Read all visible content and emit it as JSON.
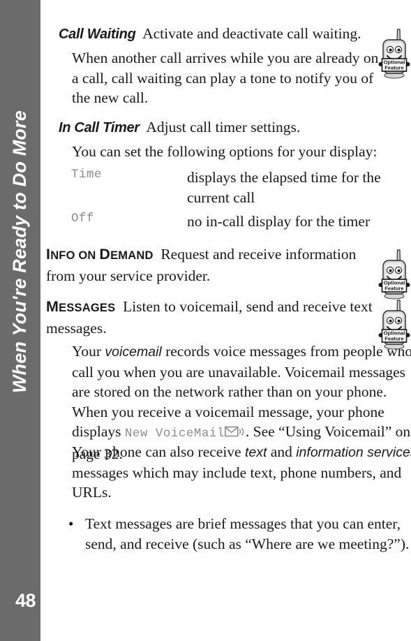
{
  "sidebar": {
    "chapter_title": "When You're Ready to Do More",
    "page_number": "48"
  },
  "content": {
    "entries": [
      {
        "term": "Call Waiting",
        "summary": "Activate and deactivate call waiting.",
        "detail": "When another call arrives while you are already on a call, call waiting can play a tone to notify you of the new call."
      },
      {
        "term": "In Call Timer",
        "summary": "Adjust call timer settings.",
        "detail": "You can set the following options for your display:"
      }
    ],
    "options": [
      {
        "name": "Time",
        "description": "displays the elapsed time for the current call"
      },
      {
        "name": "Off",
        "description": "no in-call display for the timer"
      }
    ],
    "info_on_demand": {
      "heading_first": "I",
      "heading_rest": "nfo on ",
      "heading_cap2": "D",
      "heading_rest2": "emand",
      "heading_full": "Info on Demand",
      "summary": "Request and receive information from your service provider."
    },
    "messages": {
      "heading_full": "Messages",
      "summary": "Listen to voicemail, send and receive text messages.",
      "para1_a": "Your ",
      "para1_italic": "voicemail",
      "para1_b": " records voice messages from people who call you when you are unavailable. Voicemail messages are stored on the network rather than on your phone. When you receive a voicemail message, your phone displays ",
      "para1_mono": "New VoiceMail",
      "para1_c": ". See “Using Voicemail” on page 32.",
      "para2_a": "Your phone can also receive ",
      "para2_italic1": "text",
      "para2_b": " and ",
      "para2_italic2": "information services",
      "para2_c": " messages which may include text, phone numbers, and URLs.",
      "bullet": "Text messages are brief messages that you can enter, send, and receive (such as “Where are we meeting?”)."
    }
  },
  "mascots": {
    "label_line1": "Optional",
    "label_line2": "Feature",
    "icon_name": "optional-feature-phone-mascot",
    "count": 3
  },
  "colors": {
    "sidebar_gray": "#6b6b6b",
    "body_text": "#1a1a1a",
    "mono_gray": "#8c8c8c",
    "page_background": "#ffffff"
  }
}
